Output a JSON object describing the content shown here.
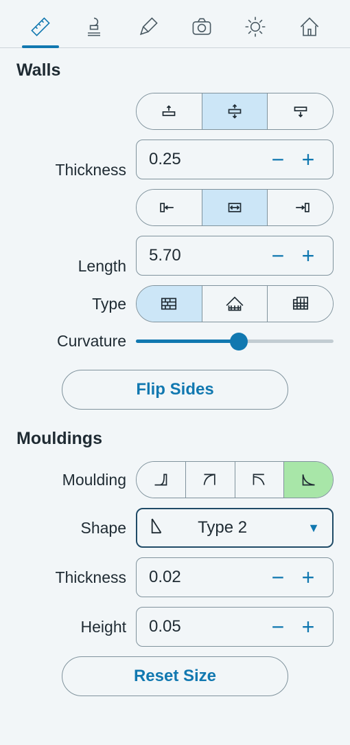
{
  "tabs": [
    "measure",
    "paint",
    "draw",
    "camera",
    "light",
    "home"
  ],
  "active_tab": 0,
  "walls": {
    "title": "Walls",
    "thickness": {
      "label": "Thickness",
      "value": "0.25",
      "mode": 1
    },
    "length": {
      "label": "Length",
      "value": "5.70",
      "mode": 1
    },
    "type": {
      "label": "Type",
      "selected": 0,
      "options": [
        "brick",
        "roof",
        "panel"
      ]
    },
    "curvature": {
      "label": "Curvature",
      "value": 0.52
    },
    "flip_label": "Flip Sides"
  },
  "mouldings": {
    "title": "Mouldings",
    "moulding": {
      "label": "Moulding",
      "selected": 3,
      "options": [
        "m1",
        "m2",
        "m3",
        "m4"
      ]
    },
    "shape": {
      "label": "Shape",
      "selected": "Type 2"
    },
    "thickness": {
      "label": "Thickness",
      "value": "0.02"
    },
    "height": {
      "label": "Height",
      "value": "0.05"
    },
    "reset_label": "Reset Size"
  }
}
